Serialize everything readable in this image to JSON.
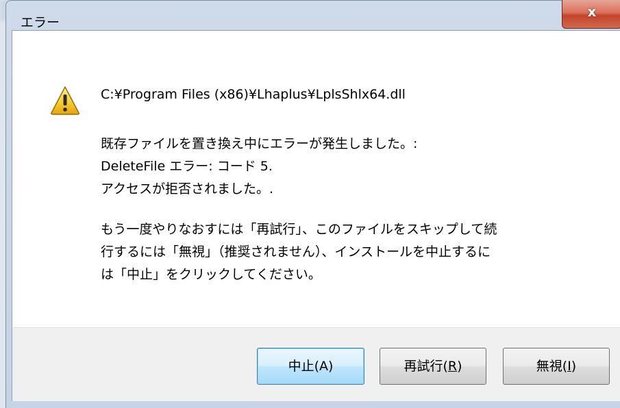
{
  "window": {
    "title": "エラー",
    "close_label": "x"
  },
  "message": {
    "path": "C:¥Program Files (x86)¥Lhaplus¥LplsShlx64.dll",
    "line1": "既存ファイルを置き換え中にエラーが発生しました。:",
    "line2": "DeleteFile エラー: コード 5.",
    "line3": "アクセスが拒否されました。.",
    "line4": "もう一度やりなおすには「再試行」、このファイルをスキップして続",
    "line5": "行するには「無視」（推奨されません）、インストールを中止するに",
    "line6": "は「中止」をクリックしてください。"
  },
  "buttons": {
    "abort": "中止(A)",
    "retry_prefix": "再試行(",
    "retry_key": "R",
    "retry_suffix": ")",
    "ignore_prefix": "無視(",
    "ignore_key": "I",
    "ignore_suffix": ")"
  },
  "icon": "warning-icon"
}
